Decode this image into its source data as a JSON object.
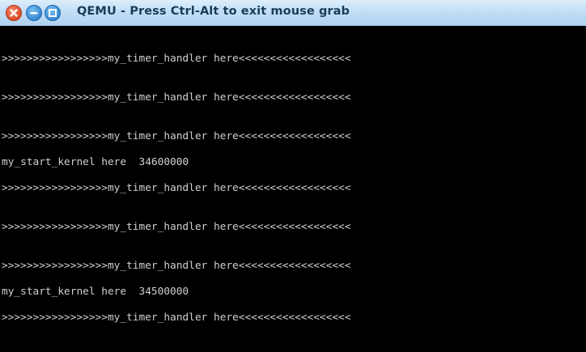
{
  "window": {
    "title": "QEMU - Press Ctrl-Alt to exit mouse grab",
    "close_icon": "close-icon",
    "minimize_icon": "minimize-icon",
    "maximize_icon": "maximize-icon",
    "close_color": "#e2532d",
    "button_color": "#3a93dd"
  },
  "console": {
    "lines": [
      ">>>>>>>>>>>>>>>>>my_timer_handler here<<<<<<<<<<<<<<<<<<",
      ">>>>>>>>>>>>>>>>>my_timer_handler here<<<<<<<<<<<<<<<<<<",
      ">>>>>>>>>>>>>>>>>my_timer_handler here<<<<<<<<<<<<<<<<<<",
      "my_start_kernel here  34600000",
      ">>>>>>>>>>>>>>>>>my_timer_handler here<<<<<<<<<<<<<<<<<<",
      ">>>>>>>>>>>>>>>>>my_timer_handler here<<<<<<<<<<<<<<<<<<",
      ">>>>>>>>>>>>>>>>>my_timer_handler here<<<<<<<<<<<<<<<<<<",
      "my_start_kernel here  34500000",
      ">>>>>>>>>>>>>>>>>my_timer_handler here<<<<<<<<<<<<<<<<<<"
    ]
  }
}
